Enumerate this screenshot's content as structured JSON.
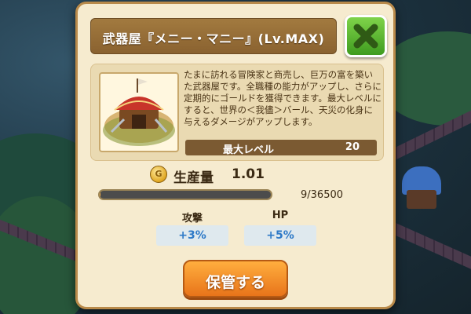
{
  "dialog": {
    "title": "武器屋『メニー・マニー』(Lv.MAX)",
    "close_icon": "close-x-icon",
    "description": "たまに訪れる冒険家と商売し、巨万の富を築いた武器屋です。全職種の能力がアップし、さらに定期的にゴールドを獲得できます。最大レベルにすると、世界の＜我儘＞バール、天災の化身に与えるダメージがアップします。",
    "max_level": {
      "label": "最大レベル",
      "value": "20"
    },
    "production": {
      "icon": "gold-coin-icon",
      "label": "生産量",
      "value": "1.01"
    },
    "progress": {
      "text": "9/36500",
      "current": 9,
      "max": 36500
    },
    "stats": {
      "attack": {
        "label": "攻撃",
        "value": "+3%"
      },
      "hp": {
        "label": "HP",
        "value": "+5%"
      }
    },
    "store_button": "保管する"
  },
  "colors": {
    "close_button": "#5fb832",
    "store_button": "#f08a26",
    "stat_value": "#2d79c7",
    "progress_fill": "#ffb347"
  }
}
